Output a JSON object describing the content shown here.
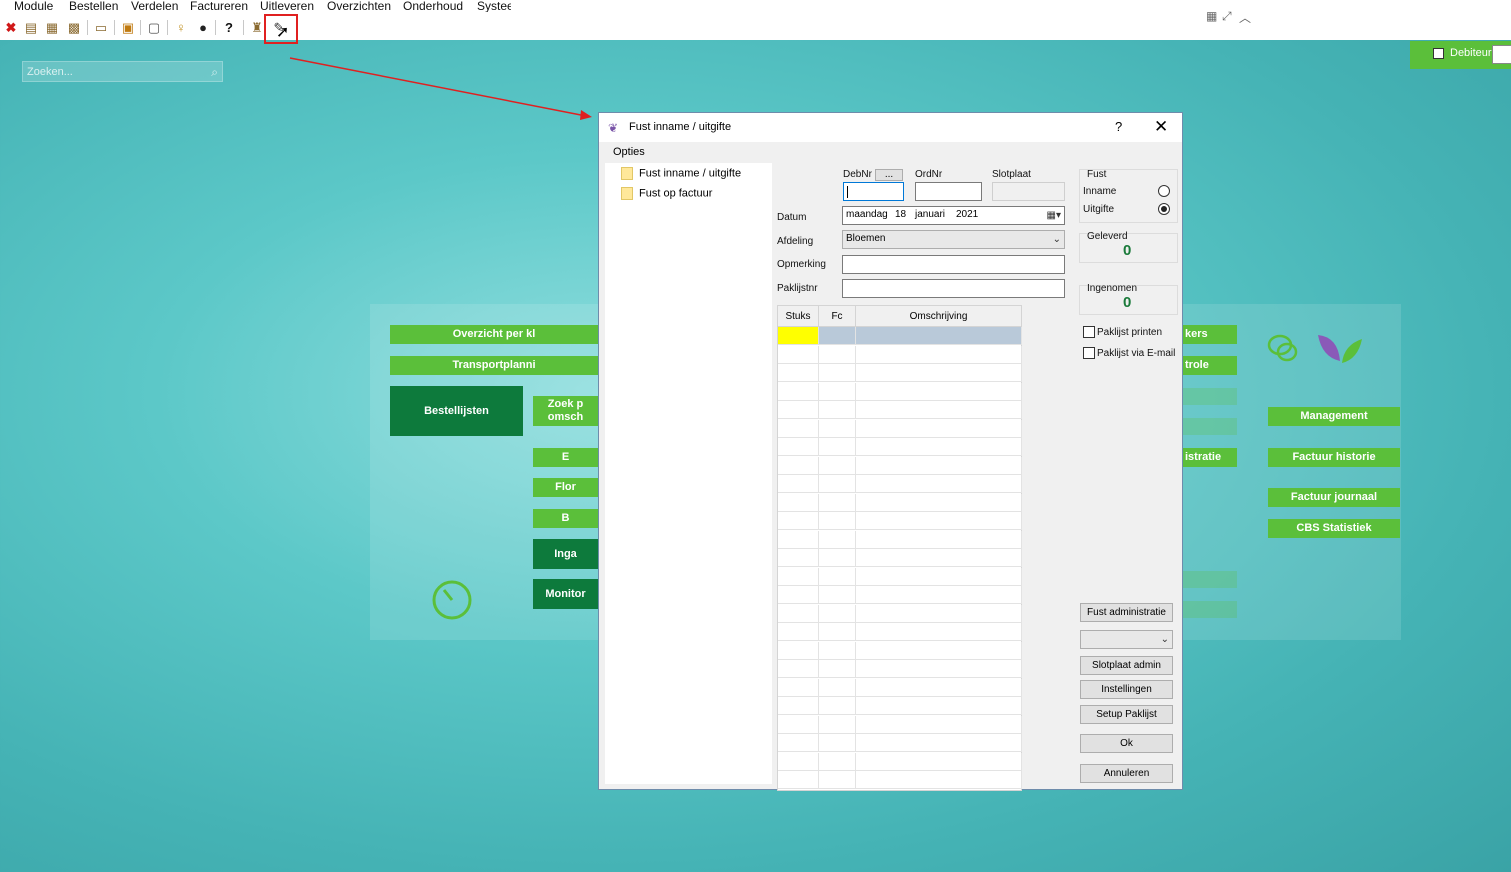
{
  "menu": [
    "Module",
    "Bestellen",
    "Verdelen",
    "Factureren",
    "Uitleveren",
    "Overzichten",
    "Onderhoud",
    "Systeem"
  ],
  "toolbar_icons": [
    "close-icon",
    "person-doc-icon",
    "doc-icon",
    "box-icon",
    "screen-icon",
    "doc-plus-icon",
    "card-icon",
    "key-icon",
    "user-icon",
    "help-icon",
    "boxes-icon",
    "fust-icon"
  ],
  "debiteur": {
    "label": "Debiteur"
  },
  "search": {
    "placeholder": "Zoeken..."
  },
  "home_buttons": {
    "overzicht": "Overzicht per kl",
    "transport": "Transportplanni",
    "bestellijsten": "Bestellijsten",
    "zoek": "Zoek p omsch",
    "e": "E",
    "flor": "Flor",
    "b": "B",
    "inga": "Inga",
    "monitor": "Monitor",
    "kers": "kers",
    "trole": "trole",
    "istratie": "istratie",
    "management": "Management",
    "factuur_historie": "Factuur historie",
    "factuur_journaal": "Factuur journaal",
    "cbs": "CBS Statistiek"
  },
  "dialog": {
    "title": "Fust inname / uitgifte",
    "help": "?",
    "close": "✕",
    "opties": "Opties",
    "tree": [
      "Fust inname / uitgifte",
      "Fust op factuur"
    ],
    "debnr_label": "DebNr",
    "debnr_button": "...",
    "ordnr_label": "OrdNr",
    "slotplaat_label": "Slotplaat",
    "datum_label": "Datum",
    "datum": {
      "weekday": "maandag",
      "day": "18",
      "month": "januari",
      "year": "2021"
    },
    "afdeling_label": "Afdeling",
    "afdeling_value": "Bloemen",
    "opmerking_label": "Opmerking",
    "paklijstnr_label": "Paklijstnr",
    "grid_headers": [
      "Stuks",
      "Fc",
      "Omschrijving"
    ],
    "fust_label": "Fust",
    "inname_label": "Inname",
    "uitgifte_label": "Uitgifte",
    "fust_mode": "Uitgifte",
    "geleverd_label": "Geleverd",
    "geleverd_value": "0",
    "ingenomen_label": "Ingenomen",
    "ingenomen_value": "0",
    "paklijst_printen": "Paklijst printen",
    "paklijst_email": "Paklijst via E-mail",
    "buttons": {
      "fust_admin": "Fust administratie",
      "slotplaat_admin": "Slotplaat admin",
      "instellingen": "Instellingen",
      "setup_paklijst": "Setup Paklijst",
      "ok": "Ok",
      "annuleren": "Annuleren"
    }
  }
}
